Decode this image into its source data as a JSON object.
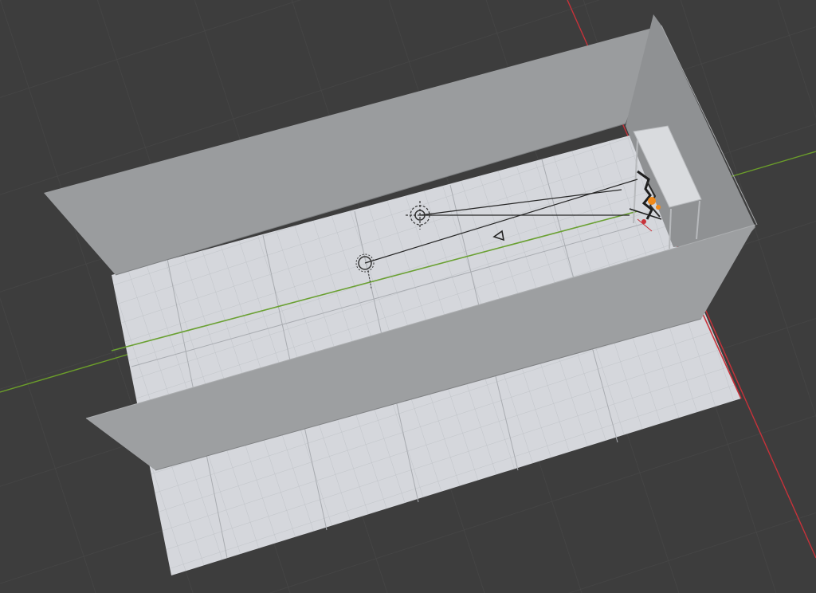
{
  "viewport": {
    "mode": "3d-perspective",
    "background_color": "#3d3d3d",
    "grid_line_color": "#474747",
    "axis_x_color": "#c8323a",
    "axis_y_color": "#6c9f2a"
  },
  "scene": {
    "floor_color": "#d5d7dc",
    "floor_grid_color": "#bcbfc4",
    "wall_color": "#9a9c9e",
    "wall_dark_color": "#8e9092",
    "selected_object_color": "#f08a1c",
    "objects": [
      {
        "type": "floor-plane",
        "icon": "plane-icon"
      },
      {
        "type": "back-wall",
        "icon": "wall-icon"
      },
      {
        "type": "front-wall",
        "icon": "wall-icon"
      },
      {
        "type": "side-wall",
        "icon": "wall-icon"
      },
      {
        "type": "table",
        "icon": "table-icon"
      },
      {
        "type": "point-light",
        "icon": "light-bulb-icon"
      },
      {
        "type": "point-light",
        "icon": "light-bulb-icon"
      },
      {
        "type": "camera",
        "icon": "camera-icon"
      },
      {
        "type": "character-rig",
        "icon": "armature-icon"
      }
    ]
  }
}
